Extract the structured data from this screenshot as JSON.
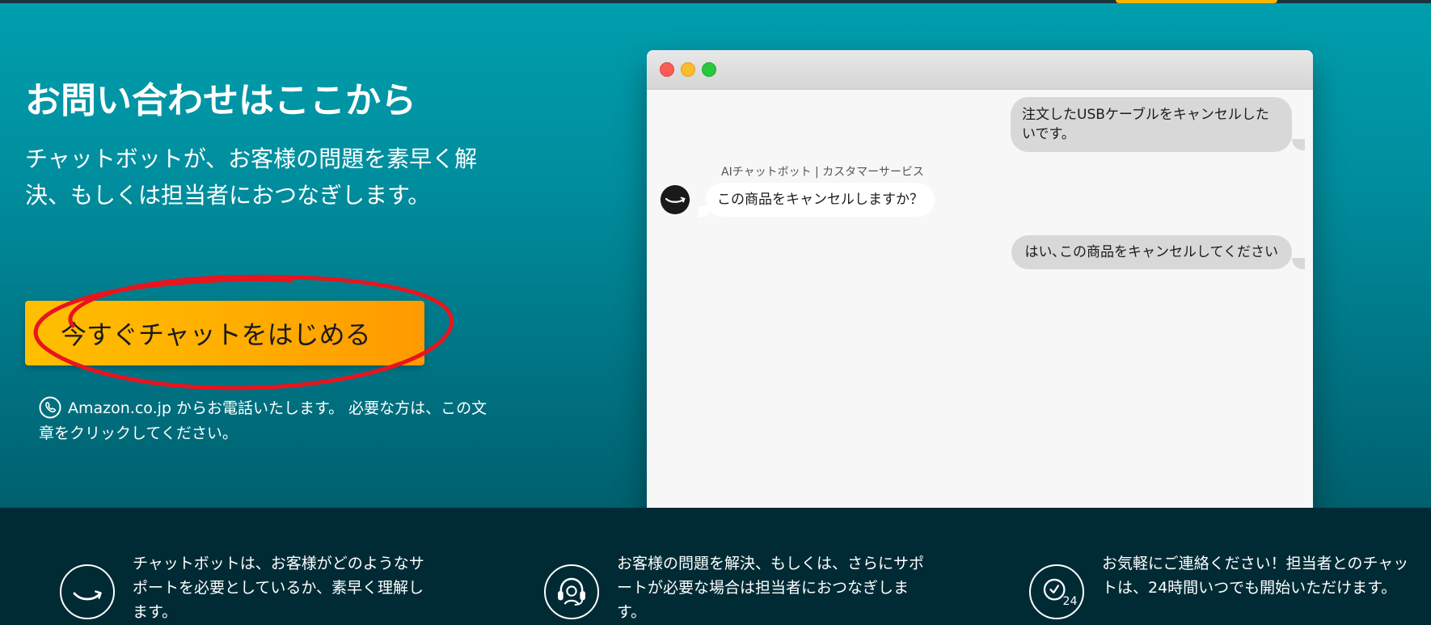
{
  "hero": {
    "title": "お問い合わせはここから",
    "description": "チャットボットが、お客様の問題を素早く解決、もしくは担当者におつなぎします。",
    "chat_button_label": "今すぐチャットをはじめる",
    "phone_note": "Amazon.co.jp からお電話いたします。 必要な方は、この文章をクリックしてください。"
  },
  "chat_window": {
    "bot_name": "AIチャットボット | カスタマーサービス",
    "messages": [
      {
        "from": "user",
        "text": "注文したUSBケーブルをキャンセルしたいです。"
      },
      {
        "from": "bot",
        "text": "この商品をキャンセルしますか？"
      },
      {
        "from": "user",
        "text": "はい､この商品をキャンセルしてください"
      }
    ]
  },
  "features": [
    {
      "icon": "amazon-smile-icon",
      "text": "チャットボットは、お客様がどのようなサポートを必要としているか、素早く理解します。"
    },
    {
      "icon": "headset-icon",
      "text": "お客様の問題を解決、もしくは、さらにサポートが必要な場合は担当者におつなぎします。"
    },
    {
      "icon": "clock-24-icon",
      "badge": "24",
      "text": "お気軽にご連絡ください！担当者とのチャットは、24時間いつでも開始いただけます。"
    }
  ],
  "colors": {
    "hero_top": "#009fae",
    "hero_bottom": "#00606e",
    "button": "#ffad00",
    "features_bg": "#002b35",
    "annotation": "#e8141e"
  }
}
